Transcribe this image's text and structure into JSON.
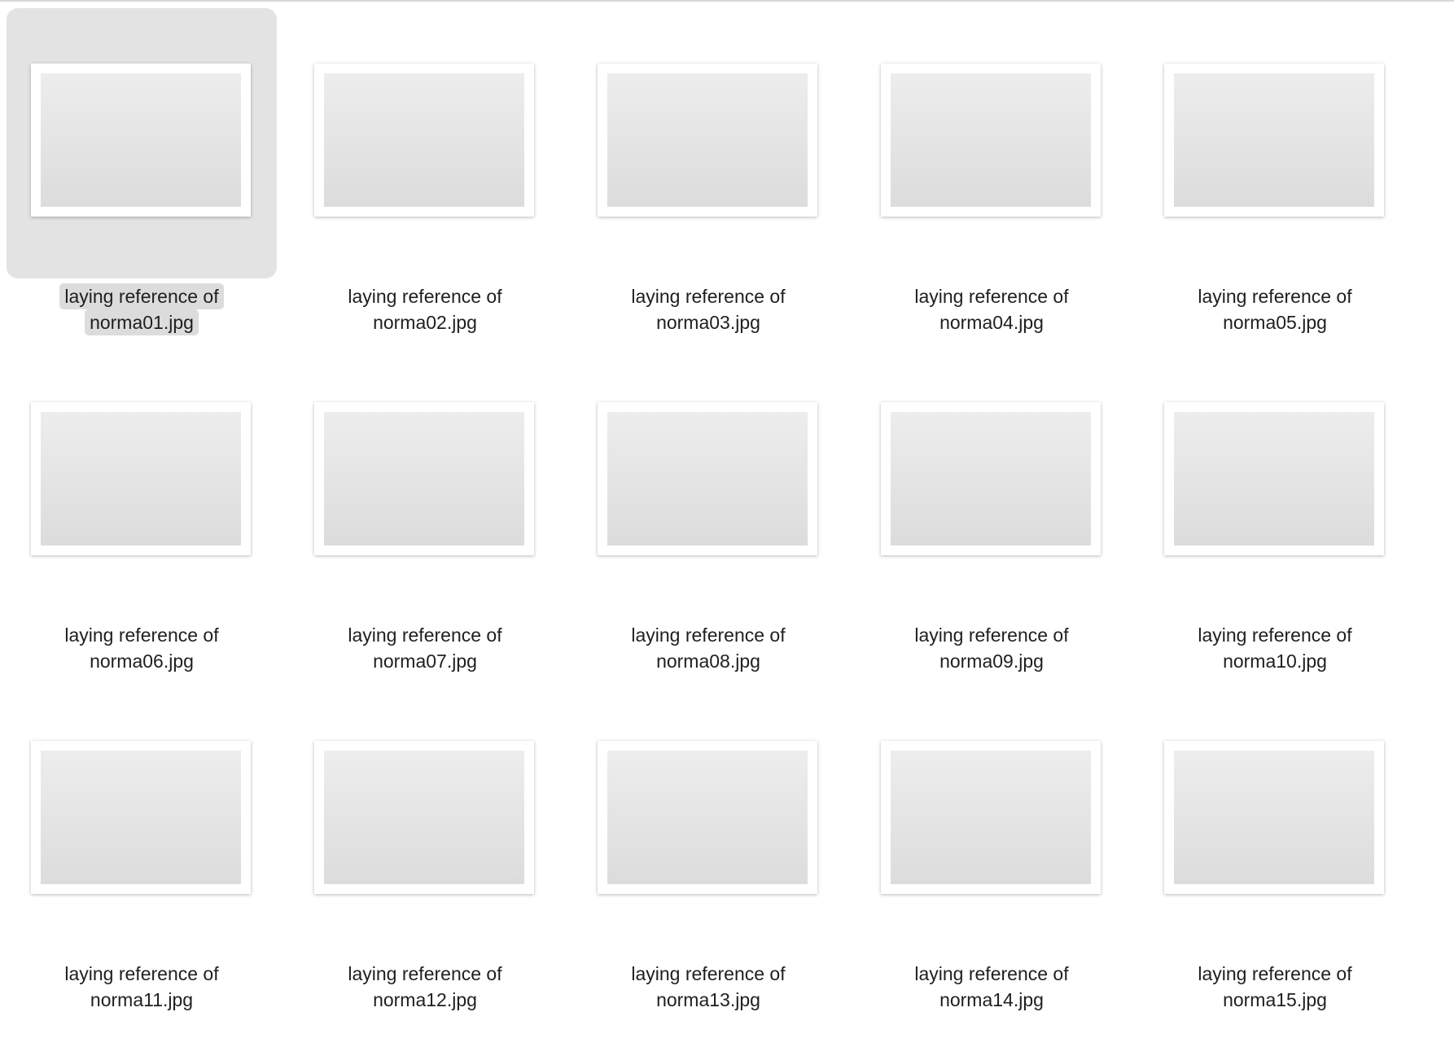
{
  "files": [
    {
      "line1": "laying reference of",
      "line2": "norma01.jpg",
      "selected": true
    },
    {
      "line1": "laying reference of",
      "line2": "norma02.jpg",
      "selected": false
    },
    {
      "line1": "laying reference of",
      "line2": "norma03.jpg",
      "selected": false
    },
    {
      "line1": "laying reference of",
      "line2": "norma04.jpg",
      "selected": false
    },
    {
      "line1": "laying reference of",
      "line2": "norma05.jpg",
      "selected": false
    },
    {
      "line1": "laying reference of",
      "line2": "norma06.jpg",
      "selected": false
    },
    {
      "line1": "laying reference of",
      "line2": "norma07.jpg",
      "selected": false
    },
    {
      "line1": "laying reference of",
      "line2": "norma08.jpg",
      "selected": false
    },
    {
      "line1": "laying reference of",
      "line2": "norma09.jpg",
      "selected": false
    },
    {
      "line1": "laying reference of",
      "line2": "norma10.jpg",
      "selected": false
    },
    {
      "line1": "laying reference of",
      "line2": "norma11.jpg",
      "selected": false
    },
    {
      "line1": "laying reference of",
      "line2": "norma12.jpg",
      "selected": false
    },
    {
      "line1": "laying reference of",
      "line2": "norma13.jpg",
      "selected": false
    },
    {
      "line1": "laying reference of",
      "line2": "norma14.jpg",
      "selected": false
    },
    {
      "line1": "laying reference of",
      "line2": "norma15.jpg",
      "selected": false
    }
  ],
  "colors": {
    "selection_bg": "#e3e3e3",
    "label_selection_bg": "#dcdcdc",
    "text": "#1f1f1f"
  }
}
